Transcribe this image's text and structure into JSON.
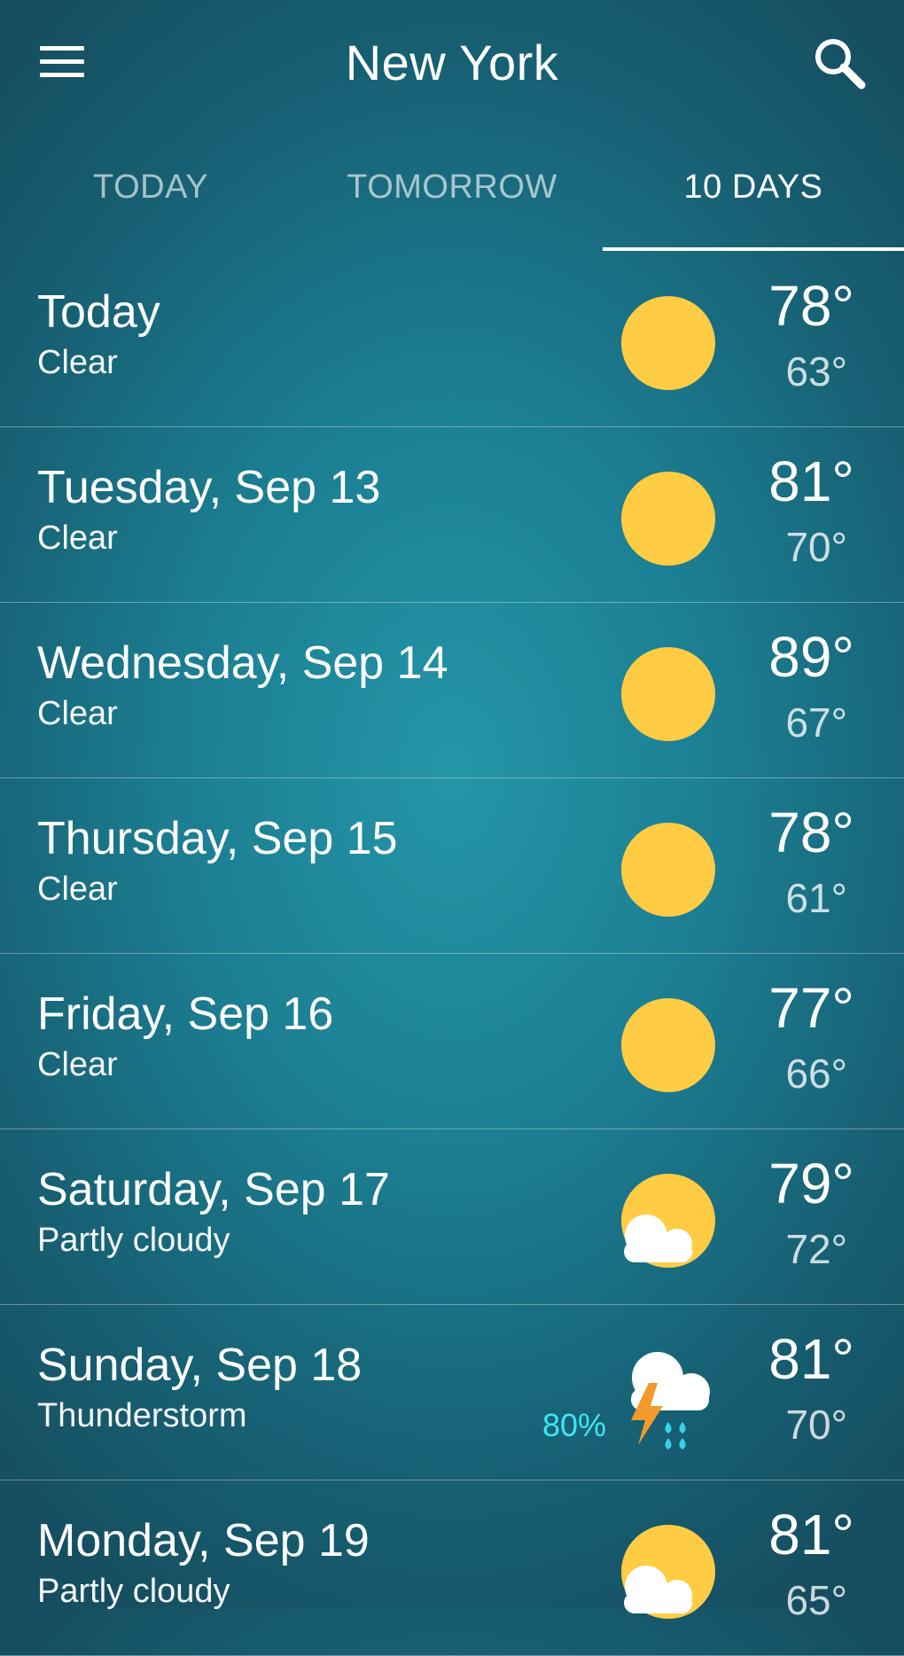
{
  "header": {
    "title": "New York",
    "menu_icon": "hamburger-menu-icon",
    "search_icon": "search-icon"
  },
  "tabs": [
    {
      "label": "TODAY",
      "active": false
    },
    {
      "label": "TOMORROW",
      "active": false
    },
    {
      "label": "10 DAYS",
      "active": true
    }
  ],
  "colors": {
    "sun": "#FFCC44",
    "sun_shadow": "#F0B43A",
    "precip_text": "#3FE5F5",
    "rain_drops": "#39D2EE",
    "lightning": "#F39A2C",
    "background_center": "#2496A8",
    "background_edge": "#154E60"
  },
  "forecast": [
    {
      "day": "Today",
      "condition": "Clear",
      "high": "78°",
      "low": "63°",
      "icon": "sun-icon",
      "precip": ""
    },
    {
      "day": "Tuesday, Sep 13",
      "condition": "Clear",
      "high": "81°",
      "low": "70°",
      "icon": "sun-icon",
      "precip": ""
    },
    {
      "day": "Wednesday, Sep 14",
      "condition": "Clear",
      "high": "89°",
      "low": "67°",
      "icon": "sun-icon",
      "precip": ""
    },
    {
      "day": "Thursday, Sep 15",
      "condition": "Clear",
      "high": "78°",
      "low": "61°",
      "icon": "sun-icon",
      "precip": ""
    },
    {
      "day": "Friday, Sep 16",
      "condition": "Clear",
      "high": "77°",
      "low": "66°",
      "icon": "sun-icon",
      "precip": ""
    },
    {
      "day": "Saturday, Sep 17",
      "condition": "Partly cloudy",
      "high": "79°",
      "low": "72°",
      "icon": "partly-cloudy-icon",
      "precip": ""
    },
    {
      "day": "Sunday, Sep 18",
      "condition": "Thunderstorm",
      "high": "81°",
      "low": "70°",
      "icon": "thunderstorm-icon",
      "precip": "80%"
    },
    {
      "day": "Monday, Sep 19",
      "condition": "Partly cloudy",
      "high": "81°",
      "low": "65°",
      "icon": "partly-cloudy-icon",
      "precip": ""
    }
  ]
}
